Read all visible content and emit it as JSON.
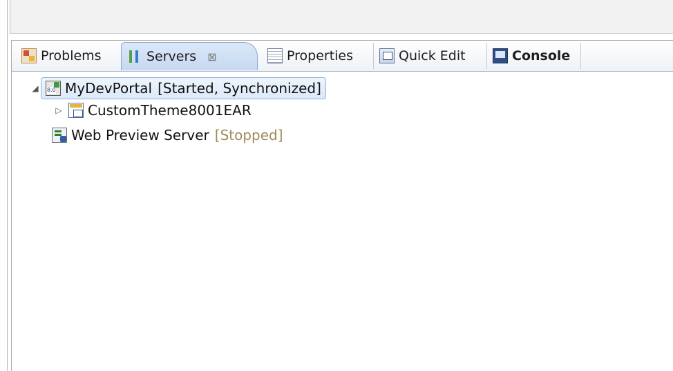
{
  "tabs": [
    {
      "label": "Problems",
      "icon": "problems-icon"
    },
    {
      "label": "Servers",
      "icon": "servers-icon",
      "active": true,
      "close": "⊠"
    },
    {
      "label": "Properties",
      "icon": "properties-icon"
    },
    {
      "label": "Quick Edit",
      "icon": "quick-edit-icon"
    },
    {
      "label": "Console",
      "icon": "console-icon"
    }
  ],
  "tree": [
    {
      "label": "MyDevPortal",
      "status": "[Started, Synchronized]",
      "expanded": true,
      "selected": true
    },
    {
      "label": "CustomTheme8001EAR",
      "expanded": false
    },
    {
      "label": "Web Preview Server",
      "status": "[Stopped]"
    }
  ],
  "colors": {
    "selection_bg": "#dce9f8",
    "selection_border": "#8fb0de",
    "stopped_status": "#a08a5a"
  }
}
